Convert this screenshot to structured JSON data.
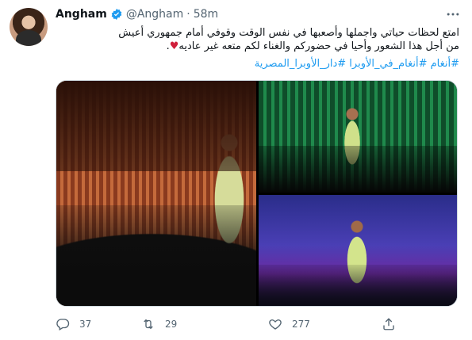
{
  "tweet": {
    "author_name": "Angham",
    "author_handle": "@Angham",
    "separator": "·",
    "time": "58m",
    "text_line1": "امتع لحظات حياتي واجملها وأصعبها في نفس الوقت وقوفي أمام جمهوري أعيش",
    "text_line2": "من أجل هذا الشعور وأحيا في حضوركم والغناء لكم متعه غير عاديه",
    "heart": "♥",
    "text_end": ".",
    "hashtags": "#أنغام #أنغام_في_الأوبرا #دار_الأوبرا_المصرية",
    "counts": {
      "replies": "37",
      "retweets": "29",
      "likes": "277"
    },
    "icons": {
      "verified": "verified-badge-icon",
      "more": "more-icon",
      "reply": "reply-icon",
      "retweet": "retweet-icon",
      "like": "heart-icon",
      "share": "share-icon"
    },
    "colors": {
      "verified": "#1d9bf0",
      "hashtag": "#1d9bf0",
      "heart": "#d01f3b",
      "muted": "#536471"
    }
  }
}
